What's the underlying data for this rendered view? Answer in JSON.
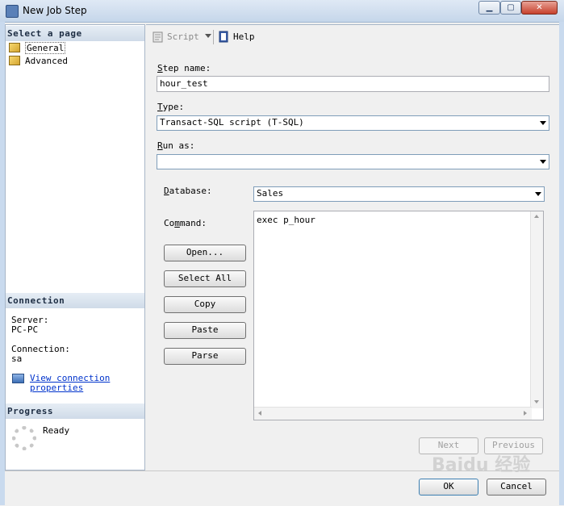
{
  "window": {
    "title": "New Job Step",
    "controls": {
      "minimize": "▁",
      "maximize": "▢",
      "close": "✕"
    }
  },
  "sidebar": {
    "select_page_header": "Select a page",
    "pages": [
      {
        "label": "General",
        "icon": "page-icon"
      },
      {
        "label": "Advanced",
        "icon": "page-icon"
      }
    ],
    "connection_header": "Connection",
    "server_label": "Server:",
    "server_value": "PC-PC",
    "connection_label": "Connection:",
    "connection_value": "sa",
    "view_link_line1": "View connection",
    "view_link_line2": "properties",
    "progress_header": "Progress",
    "progress_status": "Ready"
  },
  "toolbar": {
    "script_label": "Script",
    "help_label": "Help"
  },
  "form": {
    "step_name_label_key": "S",
    "step_name_label_rest": "tep name:",
    "step_name_value": "hour_test",
    "type_label_key": "T",
    "type_label_rest": "ype:",
    "type_value": "Transact-SQL script (T-SQL)",
    "run_as_label_key": "R",
    "run_as_label_rest": "un as:",
    "run_as_value": "",
    "database_label_pre": "",
    "database_label_key": "D",
    "database_label_rest": "atabase:",
    "database_value": "Sales",
    "command_label_pre": "Co",
    "command_label_key": "m",
    "command_label_rest": "mand:",
    "command_value": "exec p_hour"
  },
  "buttons": {
    "open": "Open...",
    "select_all": "Select All",
    "copy": "Copy",
    "paste": "Paste",
    "parse": "Parse",
    "next": "Next",
    "previous": "Previous",
    "ok": "OK",
    "cancel": "Cancel"
  },
  "watermark": "Baidu 经验"
}
